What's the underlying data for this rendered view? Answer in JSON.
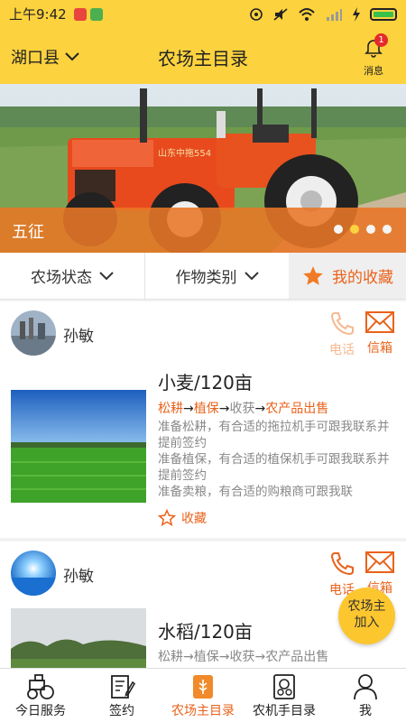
{
  "status_bar": {
    "time": "上午9:42"
  },
  "header": {
    "location": "湖口县",
    "title": "农场主目录",
    "message_count": "1",
    "message_label": "消息"
  },
  "banner": {
    "caption": "五征",
    "tractor_plate": "山东中拖554",
    "dots": 4,
    "active_dot": 1
  },
  "filters": {
    "farm_status": "农场状态",
    "crop_type": "作物类别",
    "favorites": "我的收藏"
  },
  "cards": [
    {
      "user": "孙敏",
      "phone_label": "电话",
      "mail_label": "信箱",
      "crop": "小麦/120亩",
      "steps": [
        {
          "text": "松耕",
          "highlight": true
        },
        {
          "text": "植保",
          "highlight": true
        },
        {
          "text": "收获",
          "highlight": false
        },
        {
          "text": "农产品出售",
          "highlight": true
        }
      ],
      "notes": [
        "准备松耕，有合适的拖拉机手可跟我联系并提前签约",
        "准备植保，有合适的植保机手可跟我联系并提前签约",
        "准备卖粮，有合适的购粮商可跟我联"
      ],
      "collect_label": "收藏"
    },
    {
      "user": "孙敏",
      "phone_label": "电话",
      "mail_label": "信箱",
      "crop": "水稻/120亩",
      "steps": [
        {
          "text": "松耕",
          "highlight": false
        },
        {
          "text": "植保",
          "highlight": false
        },
        {
          "text": "收获",
          "highlight": false
        },
        {
          "text": "农产品出售",
          "highlight": false
        }
      ]
    }
  ],
  "fab": {
    "line1": "农场主",
    "line2": "加入"
  },
  "tabs": [
    {
      "label": "今日服务",
      "icon": "tractor-icon"
    },
    {
      "label": "签约",
      "icon": "contract-edit-icon"
    },
    {
      "label": "农场主目录",
      "icon": "farmer-directory-icon",
      "active": true
    },
    {
      "label": "农机手目录",
      "icon": "machine-operator-icon"
    },
    {
      "label": "我",
      "icon": "profile-icon"
    }
  ],
  "colors": {
    "brand_yellow": "#fcd23e",
    "accent_orange": "#e9621b"
  }
}
